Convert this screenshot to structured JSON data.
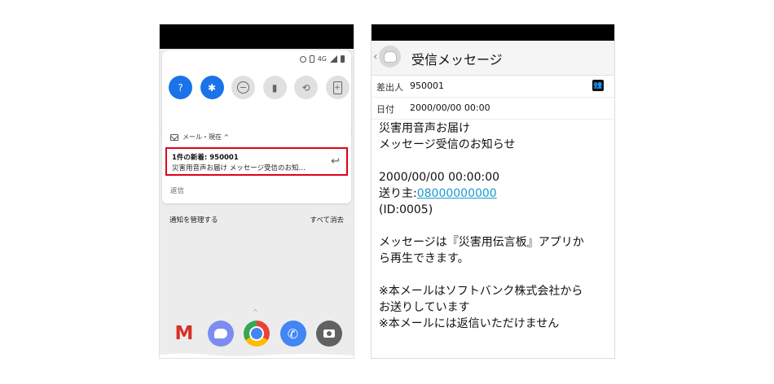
{
  "left_screen": {
    "status_bar": {
      "network": "4G"
    },
    "quick_settings": {
      "tiles": [
        {
          "name": "wifi",
          "glyph": "wifi-icon",
          "symbol": "?",
          "active": true
        },
        {
          "name": "bluetooth",
          "glyph": "bluetooth-icon",
          "symbol": "✱",
          "active": true
        },
        {
          "name": "do-not-disturb",
          "glyph": "do-not-disturb-icon",
          "symbol": "−",
          "active": false
        },
        {
          "name": "flashlight",
          "glyph": "flashlight-icon",
          "symbol": "▮",
          "active": false
        },
        {
          "name": "auto-rotate",
          "glyph": "rotate-icon",
          "symbol": "⟲",
          "active": false
        },
        {
          "name": "battery-saver",
          "glyph": "battery-icon",
          "symbol": "+",
          "active": false
        }
      ]
    },
    "notification": {
      "header": "メール・現在 ^",
      "title": "1件の新着: 950001",
      "body": "災害用音声お届け メッセージ受信のお知…",
      "action": "返信",
      "highlight_color": "#e0001a"
    },
    "tray": {
      "manage_label": "通知を管理する",
      "clear_all_label": "すべて消去"
    },
    "dock": [
      "gmail-app-icon",
      "messages-app-icon",
      "chrome-app-icon",
      "phone-app-icon",
      "camera-app-icon"
    ]
  },
  "right_screen": {
    "header_title": "受信メッセージ",
    "sender_label": "差出人",
    "sender_value": "950001",
    "date_label": "日付",
    "date_value": "2000/00/00 00:00",
    "body": {
      "line1": "災害用音声お届け",
      "line2": "メッセージ受信のお知らせ",
      "datetime": "2000/00/00 00:00:00",
      "from_prefix": "送り主:",
      "from_number": "08000000000",
      "id": "(ID:0005)",
      "note1": "メッセージは『災害用伝言板』アプリか",
      "note2": "ら再生できます。",
      "footer1": "※本メールはソフトバンク株式会社から",
      "footer2": "お送りしています",
      "footer3": "※本メールには返信いただけません"
    },
    "link_color": "#1a9bd1"
  }
}
